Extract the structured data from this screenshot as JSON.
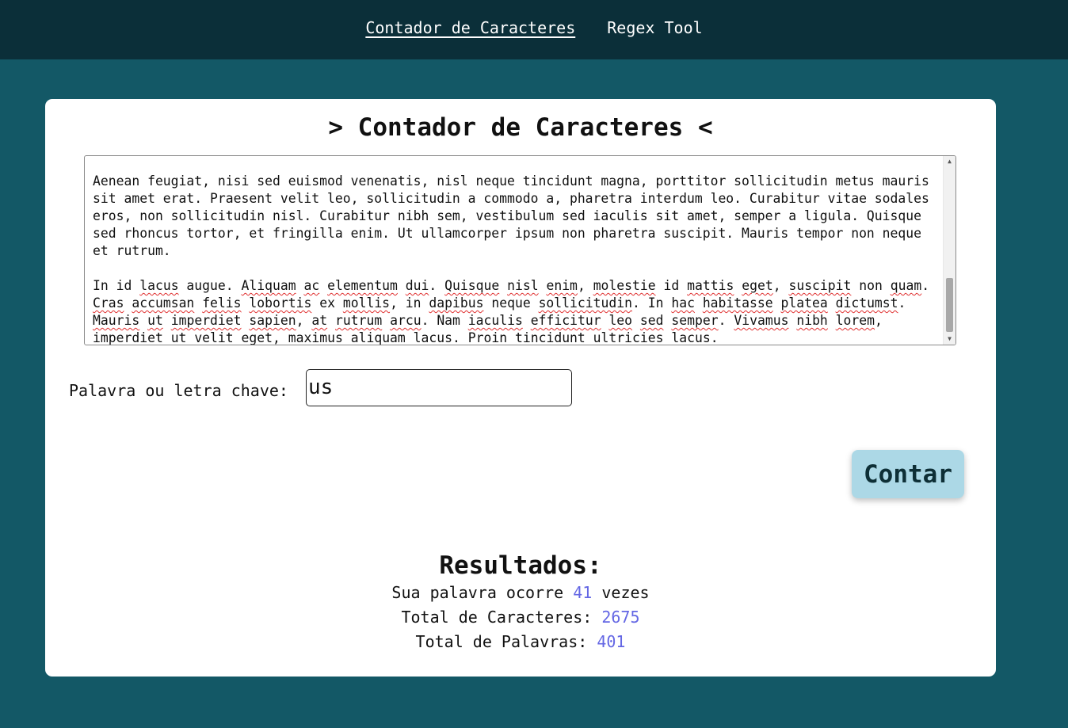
{
  "nav": {
    "links": [
      {
        "label": "Contador de Caracteres",
        "active": true
      },
      {
        "label": "Regex Tool",
        "active": false
      }
    ]
  },
  "main": {
    "title": "> Contador de Caracteres <",
    "text_area": {
      "paragraph1": "Aenean feugiat, nisi sed euismod venenatis, nisl neque tincidunt magna, porttitor sollicitudin metus mauris sit amet erat. Praesent velit leo, sollicitudin a commodo a, pharetra interdum leo. Curabitur vitae sodales eros, non sollicitudin nisl. Curabitur nibh sem, vestibulum sed iaculis sit amet, semper a ligula. Quisque sed rhoncus tortor, et fringilla enim. Ut ullamcorper ipsum non pharetra suscipit. Mauris tempor non neque et rutrum.",
      "paragraph2": "In id lacus augue. Aliquam ac elementum dui. Quisque nisl enim, molestie id mattis eget, suscipit non quam. Cras accumsan felis lobortis ex mollis, in dapibus neque sollicitudin. In hac habitasse platea dictumst. Mauris ut imperdiet sapien, at rutrum arcu. Nam iaculis efficitur leo sed semper. Vivamus nibh lorem, imperdiet ut velit eget, maximus aliquam lacus. Proin tincidunt ultricies lacus."
    },
    "keyword": {
      "label": "Palavra ou letra chave:",
      "value": "us"
    },
    "button_label": "Contar"
  },
  "results": {
    "title": "Resultados:",
    "occurrences_prefix": "Sua palavra ocorre",
    "occurrences_value": "41",
    "occurrences_suffix": "vezes",
    "chars_label": "Total de Caracteres:",
    "chars_value": "2675",
    "words_label": "Total de Palavras:",
    "words_value": "401"
  },
  "colors": {
    "background": "#135866",
    "navbar": "#0b2f39",
    "button": "#acd8e6",
    "result_number": "#6467e4"
  }
}
